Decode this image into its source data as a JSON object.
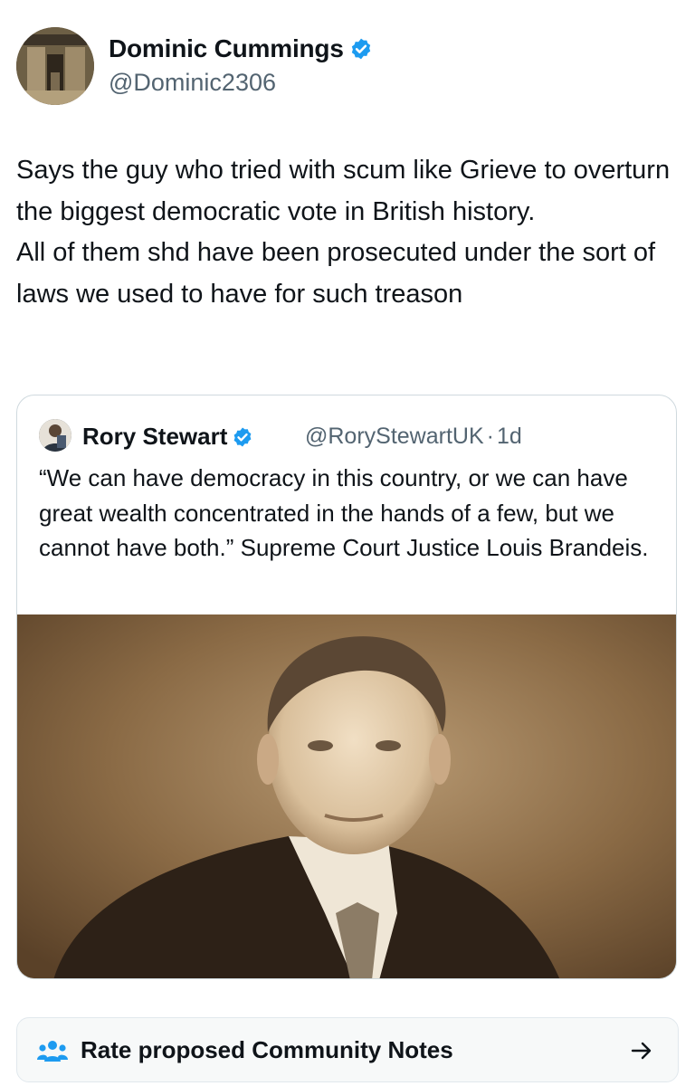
{
  "author": {
    "name": "Dominic Cummings",
    "handle": "@Dominic2306",
    "verified_color": "#1d9bf0"
  },
  "tweet": {
    "text": "Says the guy who tried with scum like Grieve to overturn the biggest democratic vote in British history.\nAll of them shd have been prosecuted under the sort of laws we used to have for such treason"
  },
  "quote": {
    "name": "Rory Stewart",
    "handle": "@RoryStewartUK",
    "separator": "·",
    "time": "1d",
    "text": "“We can have democracy in this country, or we can have great wealth concentrated in the hands of a few, but we cannot have both.” Supreme Court Justice Louis Brandeis.",
    "image": "sepia-portrait-photo"
  },
  "community_notes": {
    "label": "Rate proposed Community Notes",
    "icon": "people-icon",
    "arrow_icon": "arrow-right-icon",
    "icon_color": "#1d9bf0"
  }
}
